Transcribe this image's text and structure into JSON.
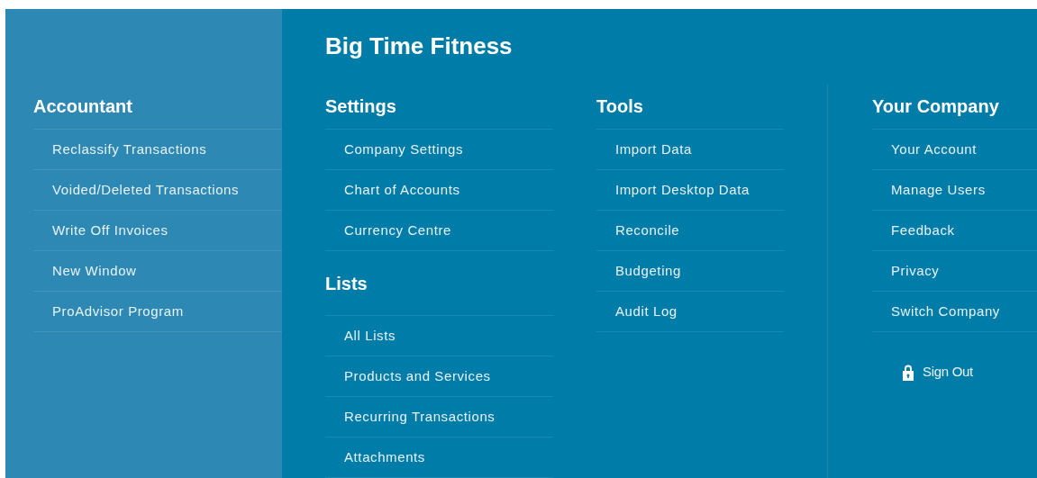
{
  "sidebar": {
    "heading": "Accountant",
    "items": [
      "Reclassify Transactions",
      "Voided/Deleted Transactions",
      "Write Off Invoices",
      "New Window",
      "ProAdvisor Program"
    ]
  },
  "company_name": "Big Time Fitness",
  "columns": [
    {
      "sections": [
        {
          "heading": "Settings",
          "items": [
            "Company Settings",
            "Chart of Accounts",
            "Currency Centre"
          ]
        },
        {
          "heading": "Lists",
          "items": [
            "All Lists",
            "Products and Services",
            "Recurring Transactions",
            "Attachments"
          ]
        }
      ]
    },
    {
      "sections": [
        {
          "heading": "Tools",
          "items": [
            "Import Data",
            "Import Desktop Data",
            "Reconcile",
            "Budgeting",
            "Audit Log"
          ]
        }
      ]
    },
    {
      "sections": [
        {
          "heading": "Your Company",
          "items": [
            "Your Account",
            "Manage Users",
            "Feedback",
            "Privacy",
            "Switch Company"
          ]
        }
      ],
      "sign_out": "Sign Out"
    }
  ]
}
